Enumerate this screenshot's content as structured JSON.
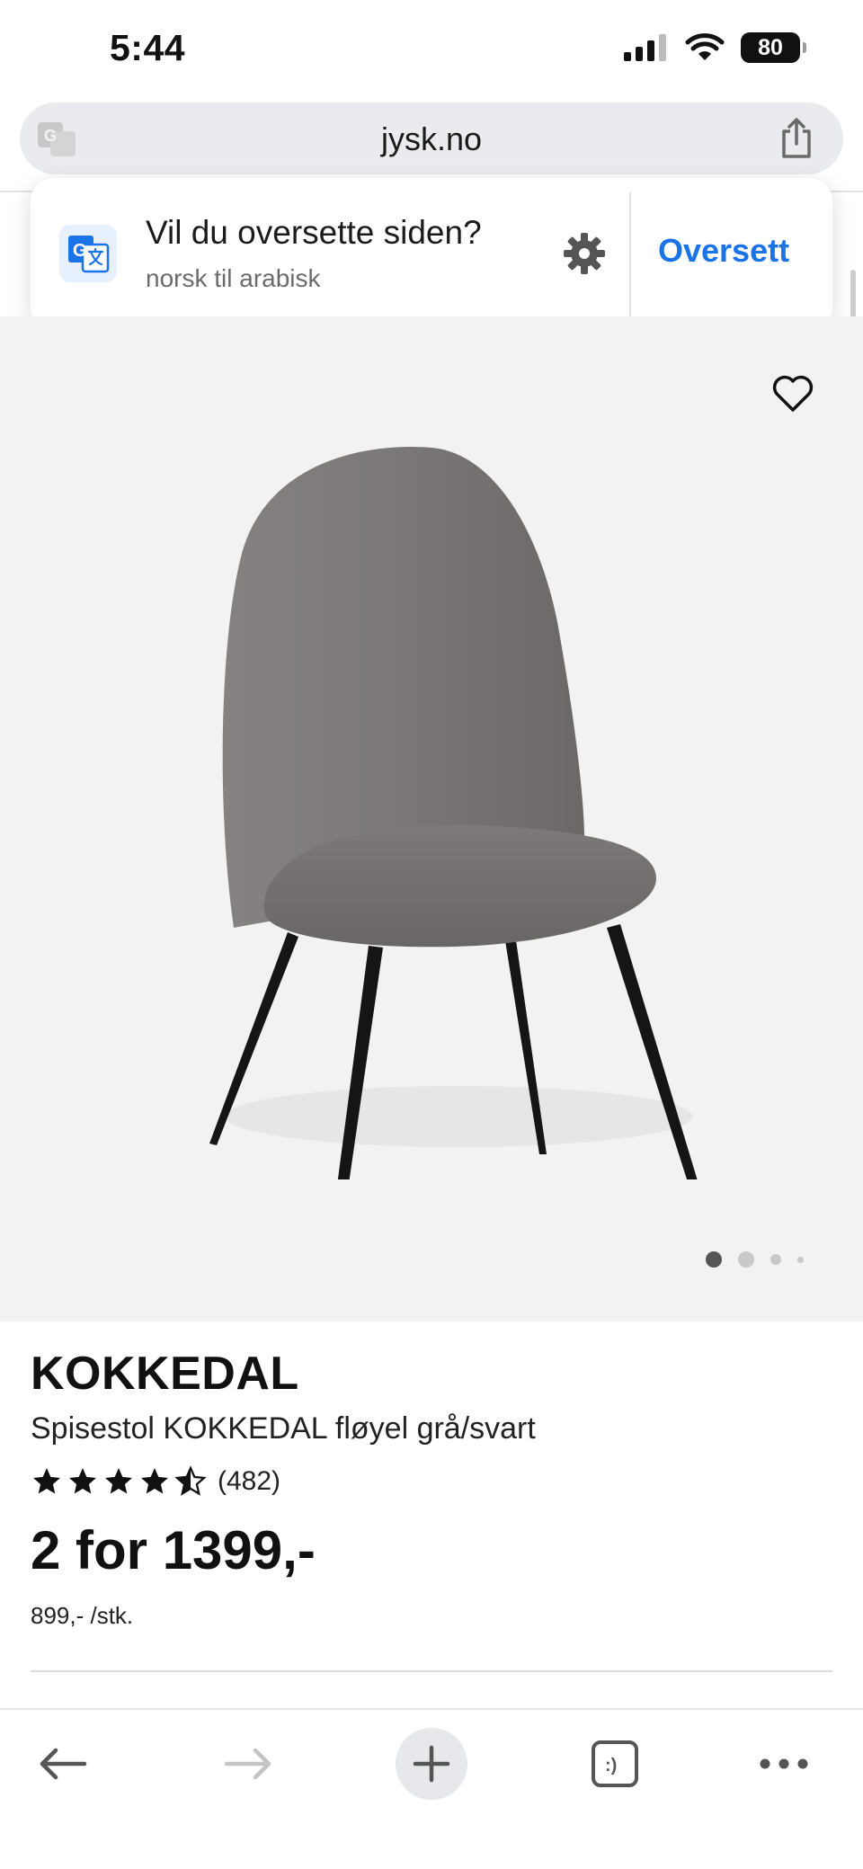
{
  "status_bar": {
    "time": "5:44",
    "battery": "80"
  },
  "address_bar": {
    "url": "jysk.no"
  },
  "translate_popup": {
    "title": "Vil du oversette siden?",
    "subtitle": "norsk til arabisk",
    "action": "Oversett"
  },
  "product": {
    "brand": "KOKKEDAL",
    "name": "Spisestol KOKKEDAL fløyel grå/svart",
    "rating": 4.5,
    "rating_count": "(482)",
    "price": "2 for 1399,-",
    "unit_price": "899,- /stk.",
    "gallery_current_index": 1,
    "gallery_count": 4
  },
  "colors": {
    "accent": "#1a73e8",
    "chair_fabric": "#7a7776",
    "gallery_bg": "#f2f2f2"
  },
  "toolbar": {
    "icons": [
      "back-arrow-icon",
      "forward-arrow-icon",
      "plus-icon",
      "tab-switcher-icon",
      "more-icon"
    ]
  }
}
